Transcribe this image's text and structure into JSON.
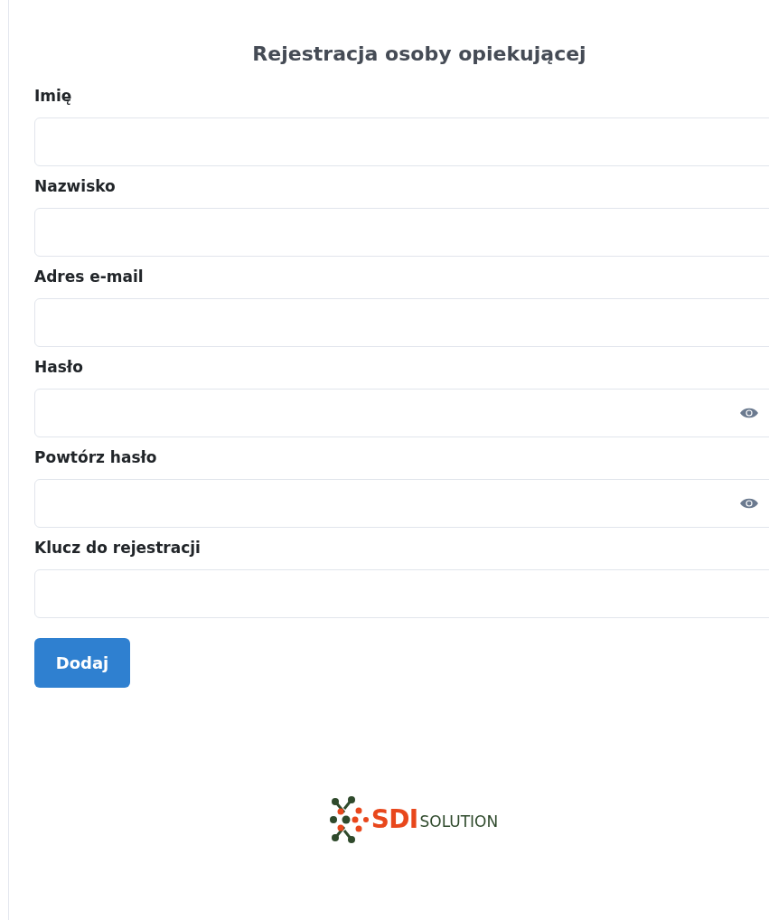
{
  "title": "Rejestracja osoby opiekującej",
  "fields": [
    {
      "label": "Imię",
      "kind": "text"
    },
    {
      "label": "Nazwisko",
      "kind": "text"
    },
    {
      "label": "Adres e-mail",
      "kind": "text"
    },
    {
      "label": "Hasło",
      "kind": "password"
    },
    {
      "label": "Powtórz hasło",
      "kind": "password"
    },
    {
      "label": "Klucz do rejestracji",
      "kind": "text"
    }
  ],
  "submit_button": "Dodaj",
  "logo": {
    "accent": "SDI",
    "rest": "SOLUTION"
  }
}
